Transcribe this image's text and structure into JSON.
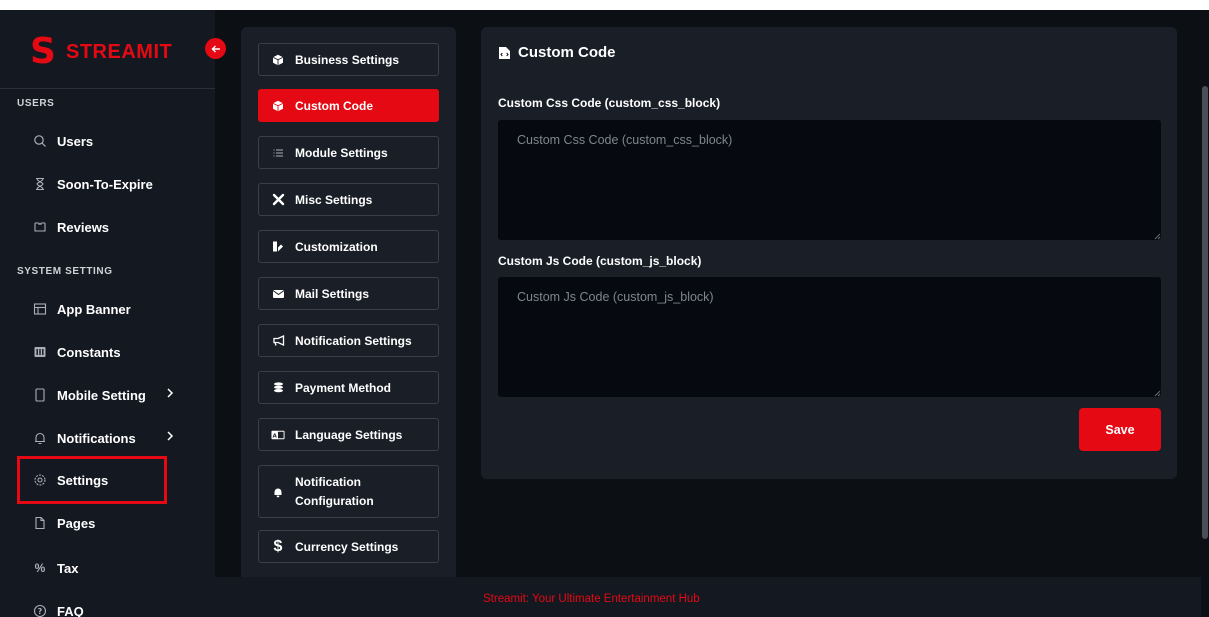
{
  "brand": {
    "name": "STREAMIT",
    "color": "#e50914"
  },
  "sidebar": {
    "sections": [
      {
        "label": "USERS"
      },
      {
        "label": "SYSTEM SETTING"
      }
    ],
    "items": [
      {
        "label": "Users",
        "icon": "user-icon"
      },
      {
        "label": "Soon-To-Expire",
        "icon": "hourglass-icon"
      },
      {
        "label": "Reviews",
        "icon": "review-icon"
      },
      {
        "label": "App Banner",
        "icon": "banner-icon"
      },
      {
        "label": "Constants",
        "icon": "constants-icon"
      },
      {
        "label": "Mobile Setting",
        "icon": "mobile-icon"
      },
      {
        "label": "Notifications",
        "icon": "bell-icon"
      },
      {
        "label": "Settings",
        "icon": "gear-icon"
      },
      {
        "label": "Pages",
        "icon": "page-icon"
      },
      {
        "label": "Tax",
        "icon": "percent-icon"
      },
      {
        "label": "FAQ",
        "icon": "help-icon"
      }
    ]
  },
  "settings_menu": {
    "items": [
      {
        "label": "Business Settings",
        "icon": "cube-icon"
      },
      {
        "label": "Custom Code",
        "icon": "cube-icon",
        "active": true
      },
      {
        "label": "Module Settings",
        "icon": "list-icon"
      },
      {
        "label": "Misc Settings",
        "icon": "tools-icon"
      },
      {
        "label": "Customization",
        "icon": "paint-icon"
      },
      {
        "label": "Mail Settings",
        "icon": "envelope-icon"
      },
      {
        "label": "Notification Settings",
        "icon": "megaphone-icon"
      },
      {
        "label": "Payment Method",
        "icon": "coins-icon"
      },
      {
        "label": "Language Settings",
        "icon": "language-icon"
      },
      {
        "label": "Notification Configuration",
        "icon": "bell-icon"
      },
      {
        "label": "Currency Settings",
        "icon": "dollar-icon"
      }
    ]
  },
  "content": {
    "title": "Custom Code",
    "css_label": "Custom Css Code (custom_css_block)",
    "css_placeholder": "Custom Css Code (custom_css_block)",
    "js_label": "Custom Js Code (custom_js_block)",
    "js_placeholder": "Custom Js Code (custom_js_block)",
    "save_label": "Save"
  },
  "footer": {
    "text": "Streamit: Your Ultimate Entertainment Hub"
  }
}
